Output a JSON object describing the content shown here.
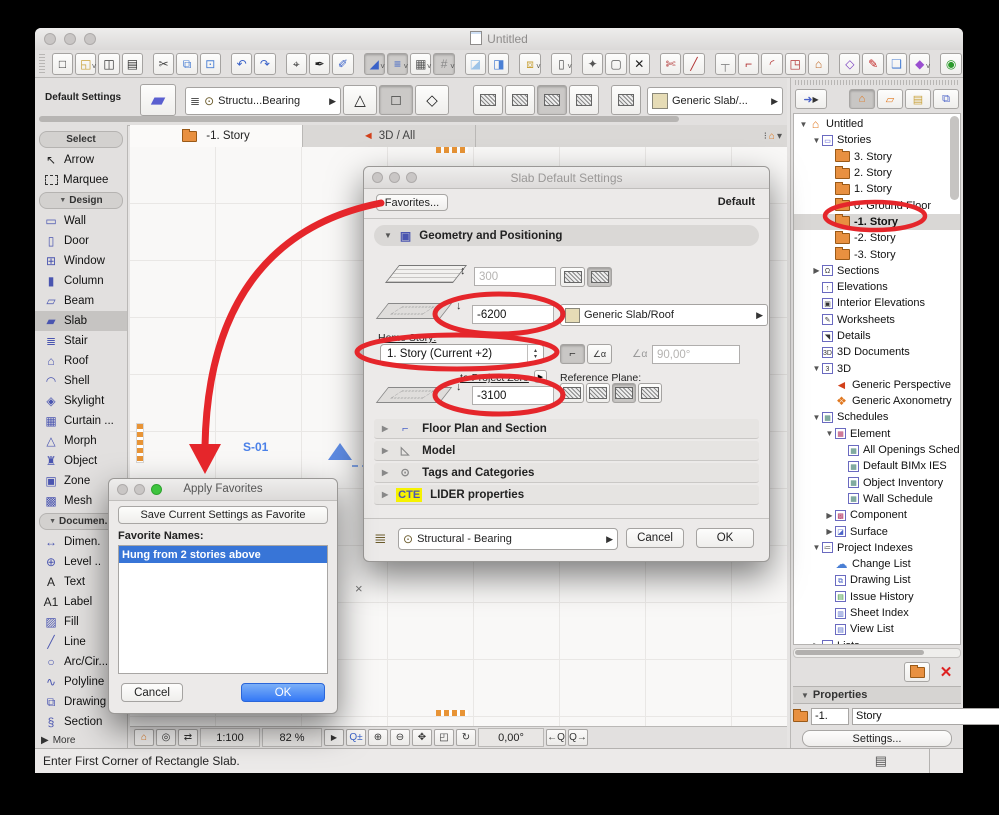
{
  "window": {
    "title": "Untitled"
  },
  "toolbar": {
    "row1": [
      {
        "n": "new-document",
        "g": "□",
        "c": "#333"
      },
      {
        "n": "open-project",
        "g": "◱",
        "c": "#c9a23a",
        "v": 1
      },
      {
        "n": "save",
        "g": "◫",
        "c": "#333"
      },
      {
        "n": "print",
        "g": "▤",
        "c": "#333"
      },
      {
        "n": "cut",
        "g": "✂",
        "c": "#444",
        "gap": 1
      },
      {
        "n": "copy",
        "g": "⧉",
        "c": "#4a7fd4"
      },
      {
        "n": "paste",
        "g": "⊡",
        "c": "#4a7fd4"
      },
      {
        "n": "undo",
        "g": "↶",
        "c": "#3a62c8",
        "gap": 1
      },
      {
        "n": "redo",
        "g": "↷",
        "c": "#3a62c8"
      },
      {
        "n": "find-select",
        "g": "⌖",
        "c": "#333",
        "gap": 1
      },
      {
        "n": "pick-up-parameters",
        "g": "✒",
        "c": "#222"
      },
      {
        "n": "inject-parameters",
        "g": "✐",
        "c": "#3a62c8"
      },
      {
        "n": "gravity",
        "g": "◢",
        "c": "#3a62c8",
        "v": 1,
        "sel": 1,
        "gap": 1
      },
      {
        "n": "guide-lines",
        "g": "≡",
        "c": "#3a62c8",
        "v": 1,
        "sel": 1
      },
      {
        "n": "coordinates",
        "g": "▦",
        "c": "#555",
        "v": 1
      },
      {
        "n": "snap-grid",
        "g": "#",
        "c": "#888",
        "v": 1,
        "sel": 1
      },
      {
        "n": "trace-reference",
        "g": "◪",
        "c": "#9ec4e8",
        "gap": 1
      },
      {
        "n": "virtual-trace",
        "g": "◨",
        "c": "#4a7fd4"
      },
      {
        "n": "layers-quick",
        "g": "⧈",
        "c": "#c9a23a",
        "v": 1,
        "gap": 1
      },
      {
        "n": "element-information",
        "g": "▯",
        "c": "#555",
        "v": 1,
        "gap": 1
      },
      {
        "n": "magic-wand",
        "g": "✦",
        "c": "#555",
        "gap": 1
      },
      {
        "n": "marquee-options",
        "g": "▢",
        "c": "#555"
      },
      {
        "n": "delete-element",
        "g": "✕",
        "c": "#222"
      },
      {
        "n": "intersect",
        "g": "✄",
        "c": "#b03030",
        "gap": 1
      },
      {
        "n": "split",
        "g": "╱",
        "c": "#b03030"
      },
      {
        "n": "adjust",
        "g": "┬",
        "c": "#888",
        "gap": 1
      },
      {
        "n": "corner-edit",
        "g": "⌐",
        "c": "#b03030"
      },
      {
        "n": "fillet-chamfer",
        "g": "◜",
        "c": "#b03030"
      },
      {
        "n": "resize",
        "g": "◳",
        "c": "#b03030"
      },
      {
        "n": "stretch-home",
        "g": "⌂",
        "c": "#c06a28"
      },
      {
        "n": "polygon-edit",
        "g": "◇",
        "c": "#7a3fc0",
        "gap": 1
      },
      {
        "n": "pen-sets",
        "g": "✎",
        "c": "#c02020"
      },
      {
        "n": "element-transfer",
        "g": "❑",
        "c": "#4a7fd4"
      },
      {
        "n": "favorites-palette",
        "g": "◆",
        "c": "#9a4fd0",
        "v": 1
      },
      {
        "n": "start-edit-mode",
        "g": "◉",
        "c": "#2a9a2a",
        "gap": 1
      }
    ]
  },
  "infobox": {
    "label": "Default Settings",
    "layer_value": "Structu...Bearing",
    "surface_value": "Generic Slab/..."
  },
  "toolbox": {
    "sections": [
      {
        "header": "Select",
        "arrow": 0,
        "items": [
          {
            "label": "Arrow",
            "g": "↖",
            "c": "#222"
          },
          {
            "label": "Marquee",
            "g": "",
            "c": "#222",
            "dashed": 1
          }
        ]
      },
      {
        "header": "Design",
        "arrow": 1,
        "items": [
          {
            "label": "Wall",
            "g": "▭"
          },
          {
            "label": "Door",
            "g": "▯"
          },
          {
            "label": "Window",
            "g": "⊞"
          },
          {
            "label": "Column",
            "g": "▮"
          },
          {
            "label": "Beam",
            "g": "▱"
          },
          {
            "label": "Slab",
            "g": "▰",
            "sel": 1
          },
          {
            "label": "Stair",
            "g": "≣"
          },
          {
            "label": "Roof",
            "g": "⌂"
          },
          {
            "label": "Shell",
            "g": "◠"
          },
          {
            "label": "Skylight",
            "g": "◈"
          },
          {
            "label": "Curtain ...",
            "g": "▦"
          },
          {
            "label": "Morph",
            "g": "△"
          },
          {
            "label": "Object",
            "g": "♜"
          },
          {
            "label": "Zone",
            "g": "▣"
          },
          {
            "label": "Mesh",
            "g": "▩"
          }
        ]
      },
      {
        "header": "Documen...",
        "arrow": 1,
        "items": [
          {
            "label": "Dimen.",
            "g": "↔"
          },
          {
            "label": "Level ..",
            "g": "⊕"
          },
          {
            "label": "Text",
            "g": "A",
            "c": "#222"
          },
          {
            "label": "Label",
            "g": "A1",
            "c": "#222"
          },
          {
            "label": "Fill",
            "g": "▨"
          },
          {
            "label": "Line",
            "g": "╱"
          },
          {
            "label": "Arc/Cir...",
            "g": "○"
          },
          {
            "label": "Polyline",
            "g": "∿"
          },
          {
            "label": "Drawing",
            "g": "⧉"
          },
          {
            "label": "Section",
            "g": "§"
          }
        ]
      }
    ],
    "more_label": "More"
  },
  "tabs": {
    "items": [
      {
        "label": "-1. Story",
        "icon": "folder",
        "active": 1
      },
      {
        "label": "3D / All",
        "icon": "camera",
        "active": 0
      }
    ]
  },
  "canvas": {
    "section_marker": "S-01"
  },
  "bottombar": {
    "items": [
      {
        "n": "quick-options",
        "g": "⌂",
        "c": "#e07820"
      },
      {
        "n": "zoom-to-selection",
        "g": "◎",
        "c": "#333"
      },
      {
        "n": "pan-route",
        "g": "⇄",
        "c": "#333"
      }
    ],
    "scale": "1:100",
    "zoom": "82 %",
    "expand": "▶",
    "zoombtns": [
      {
        "n": "zoom-options",
        "g": "Q±",
        "c": "#3a62c8"
      },
      {
        "n": "zoom-in",
        "g": "⊕",
        "c": "#333"
      },
      {
        "n": "zoom-out",
        "g": "⊖",
        "c": "#333"
      },
      {
        "n": "pan-hand",
        "g": "✥",
        "c": "#333"
      },
      {
        "n": "zoom-area",
        "g": "◰",
        "c": "#333"
      },
      {
        "n": "rotate-view",
        "g": "↻",
        "c": "#333"
      }
    ],
    "angle": "0,00°",
    "navbtns": [
      {
        "n": "previous-zoom",
        "g": "←Q",
        "c": "#333"
      },
      {
        "n": "next-zoom",
        "g": "Q→",
        "c": "#333"
      }
    ]
  },
  "statusbar": {
    "message": "Enter First Corner of Rectangle Slab."
  },
  "navigator": {
    "header": {
      "chooser_glyph": "➜",
      "tabs": [
        {
          "n": "project-map",
          "g": "⌂",
          "c": "#e07820",
          "sel": 1
        },
        {
          "n": "view-map",
          "g": "▱",
          "c": "#e07820"
        },
        {
          "n": "layout-book",
          "g": "▤",
          "c": "#c9a23a"
        },
        {
          "n": "publisher-sets",
          "g": "⧉",
          "c": "#4a62c8"
        }
      ]
    },
    "tree": [
      {
        "label": "Untitled",
        "lvl": 0,
        "ar": "d",
        "ic": "g",
        "g": "⌂",
        "c": "#e07820"
      },
      {
        "label": "Stories",
        "lvl": 1,
        "ar": "d",
        "ic": "b",
        "g": "▭",
        "c": "#4a4ad0"
      },
      {
        "label": "3. Story",
        "lvl": 2,
        "ic": "f"
      },
      {
        "label": "2. Story",
        "lvl": 2,
        "ic": "f"
      },
      {
        "label": "1. Story",
        "lvl": 2,
        "ic": "f"
      },
      {
        "label": "0. Ground Floor",
        "lvl": 2,
        "ic": "f"
      },
      {
        "label": "-1. Story",
        "lvl": 2,
        "ic": "f",
        "b": 1,
        "sel": 1
      },
      {
        "label": "-2. Story",
        "lvl": 2,
        "ic": "f"
      },
      {
        "label": "-3. Story",
        "lvl": 2,
        "ic": "f"
      },
      {
        "label": "Sections",
        "lvl": 1,
        "ar": "r",
        "ic": "b",
        "g": "Ω",
        "c": "#333"
      },
      {
        "label": "Elevations",
        "lvl": 1,
        "ic": "b",
        "g": "↑",
        "c": "#333"
      },
      {
        "label": "Interior Elevations",
        "lvl": 1,
        "ic": "b",
        "g": "▣",
        "c": "#333"
      },
      {
        "label": "Worksheets",
        "lvl": 1,
        "ic": "b",
        "g": "✎",
        "c": "#333"
      },
      {
        "label": "Details",
        "lvl": 1,
        "ic": "b",
        "g": "◥",
        "c": "#333"
      },
      {
        "label": "3D Documents",
        "lvl": 1,
        "ic": "b",
        "g": "3D",
        "c": "#333"
      },
      {
        "label": "3D",
        "lvl": 1,
        "ar": "d",
        "ic": "b",
        "g": "3",
        "c": "#333"
      },
      {
        "label": "Generic Perspective",
        "lvl": 2,
        "ic": "g",
        "g": "◄",
        "c": "#d2401a"
      },
      {
        "label": "Generic Axonometry",
        "lvl": 2,
        "ic": "g",
        "g": "❖",
        "c": "#e07820"
      },
      {
        "label": "Schedules",
        "lvl": 1,
        "ar": "d",
        "ic": "b",
        "g": "▦",
        "c": "#3a7a6a"
      },
      {
        "label": "Element",
        "lvl": 2,
        "ar": "d",
        "ic": "b",
        "g": "▦",
        "c": "#b03060"
      },
      {
        "label": "All Openings Sched",
        "lvl": 3,
        "ic": "b",
        "g": "▦",
        "c": "#3a7a6a"
      },
      {
        "label": "Default BIMx IES",
        "lvl": 3,
        "ic": "b",
        "g": "▦",
        "c": "#3a7a6a"
      },
      {
        "label": "Object Inventory",
        "lvl": 3,
        "ic": "b",
        "g": "▦",
        "c": "#3a7a6a"
      },
      {
        "label": "Wall Schedule",
        "lvl": 3,
        "ic": "b",
        "g": "▦",
        "c": "#3a7a6a"
      },
      {
        "label": "Component",
        "lvl": 2,
        "ar": "r",
        "ic": "b",
        "g": "▩",
        "c": "#b03060"
      },
      {
        "label": "Surface",
        "lvl": 2,
        "ar": "r",
        "ic": "b",
        "g": "◪",
        "c": "#4a62c8"
      },
      {
        "label": "Project Indexes",
        "lvl": 1,
        "ar": "d",
        "ic": "b",
        "g": "≔",
        "c": "#333"
      },
      {
        "label": "Change List",
        "lvl": 2,
        "ic": "g",
        "g": "☁",
        "c": "#4a7fd4"
      },
      {
        "label": "Drawing List",
        "lvl": 2,
        "ic": "b",
        "g": "⧉",
        "c": "#4a62c8"
      },
      {
        "label": "Issue History",
        "lvl": 2,
        "ic": "b",
        "g": "▤",
        "c": "#2a8a2a"
      },
      {
        "label": "Sheet Index",
        "lvl": 2,
        "ic": "b",
        "g": "▥",
        "c": "#4a62c8"
      },
      {
        "label": "View List",
        "lvl": 2,
        "ic": "b",
        "g": "▤",
        "c": "#4a62c8"
      },
      {
        "label": "Lists",
        "lvl": 1,
        "ar": "r",
        "ic": "b",
        "g": "≣",
        "c": "#333"
      }
    ],
    "properties": {
      "header": "Properties",
      "story_number": "-1.",
      "story_name": "Story",
      "settings_button": "Settings..."
    }
  },
  "slab_dialog": {
    "title": "Slab Default Settings",
    "favorites_button": "Favorites...",
    "default_label": "Default",
    "geometry_section": "Geometry and Positioning",
    "thickness_value": "300",
    "top_offset_value": "-6200",
    "home_story_label": "Home Story:",
    "home_story_value": "1. Story (Current +2)",
    "surface_value": "Generic Slab/Roof",
    "angle_value": "90,00°",
    "to_project_zero_label": "to Project Zero",
    "reference_plane_label": "Reference Plane:",
    "bottom_offset_value": "-3100",
    "sections": [
      {
        "label": "Floor Plan and Section",
        "g": "⌐",
        "c": "#4a62c8"
      },
      {
        "label": "Model",
        "g": "◺",
        "c": "#888"
      },
      {
        "label": "Tags and Categories",
        "g": "⊙",
        "c": "#888"
      },
      {
        "label": "LIDER properties",
        "g": "CTE",
        "badge": 1
      }
    ],
    "layer_value": "Structural - Bearing",
    "cancel_label": "Cancel",
    "ok_label": "OK"
  },
  "favorites_dialog": {
    "title": "Apply Favorites",
    "save_button": "Save Current Settings as Favorite",
    "names_label": "Favorite Names:",
    "items": [
      {
        "label": "Hung from 2 stories above",
        "sel": 1
      }
    ],
    "cancel_label": "Cancel",
    "ok_label": "OK"
  },
  "colors": {
    "annotation_red": "#e5262b",
    "selection_blue": "#3875d7",
    "folder_orange": "#e89040"
  }
}
